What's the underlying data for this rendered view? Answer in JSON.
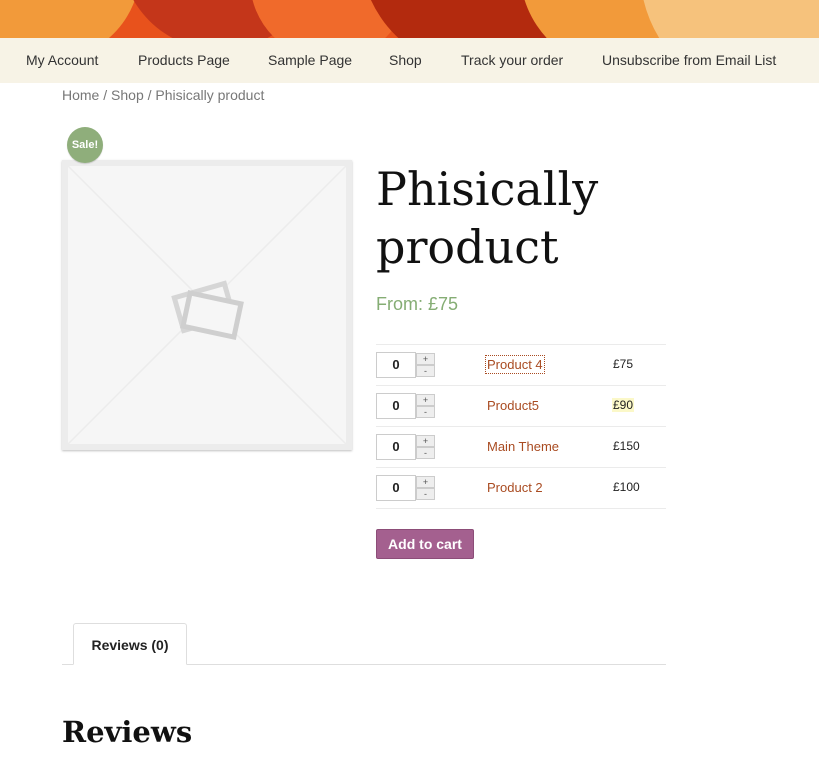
{
  "header": {
    "banner_colors": [
      "#e8521c",
      "#b32a0e",
      "#f29a3a",
      "#f6c27c"
    ]
  },
  "nav": {
    "items": [
      "My Account",
      "Products Page",
      "Sample Page",
      "Shop",
      "Track your order",
      "Unsubscribe from Email List"
    ]
  },
  "breadcrumb": {
    "home": "Home",
    "sep": " / ",
    "shop": "Shop",
    "current": "Phisically product"
  },
  "product": {
    "sale_badge": "Sale!",
    "title": "Phisically product",
    "price": "From: £75",
    "image_icon": "placeholder-image-icon"
  },
  "grouped": {
    "plus": "+",
    "minus": "-",
    "rows": [
      {
        "qty": "0",
        "name": "Product 4",
        "price": "£75"
      },
      {
        "qty": "0",
        "name": "Product5",
        "price": "£90"
      },
      {
        "qty": "0",
        "name": "Main Theme",
        "price": "£150"
      },
      {
        "qty": "0",
        "name": "Product 2",
        "price": "£100"
      }
    ]
  },
  "actions": {
    "add_to_cart": "Add to cart"
  },
  "tabs": {
    "reviews_tab": "Reviews (0)"
  },
  "reviews": {
    "heading": "Reviews"
  },
  "colors": {
    "accent_link": "#a94b21",
    "price_green": "#85ad74",
    "button_purple": "#a4608f",
    "nav_bg": "#f7f3e6"
  }
}
